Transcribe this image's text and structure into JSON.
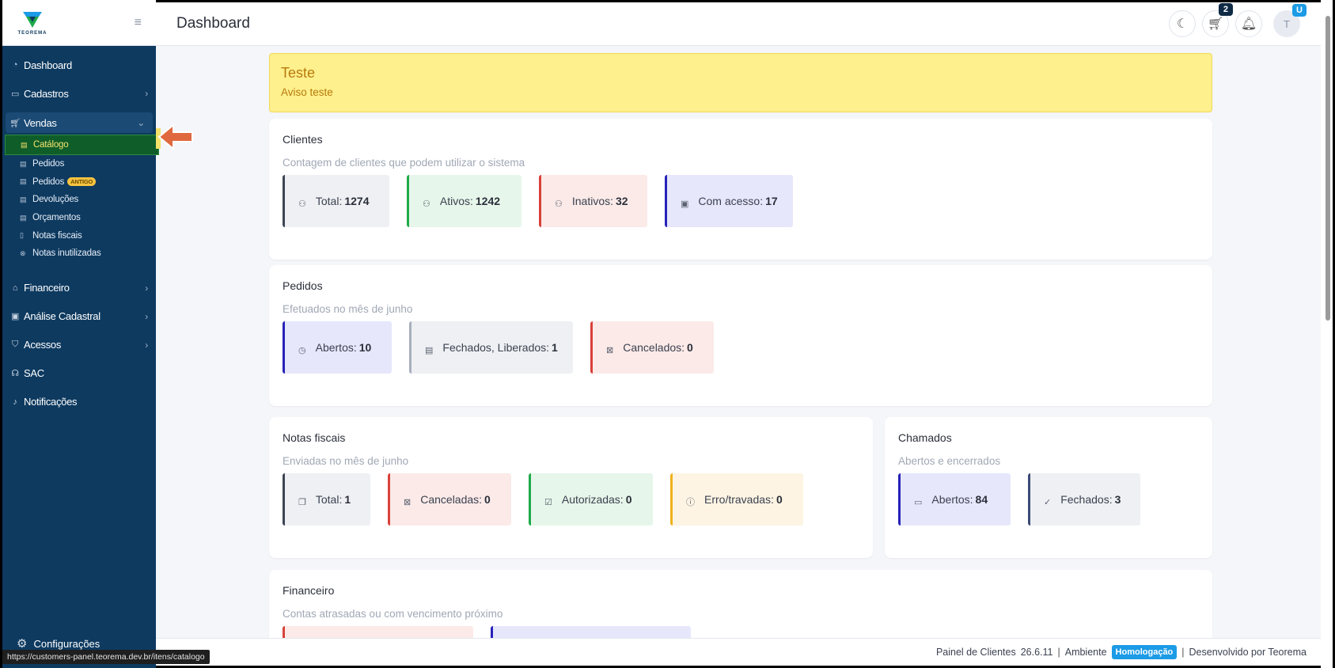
{
  "app": {
    "logo_text": "TEOREMA",
    "page_title": "Dashboard"
  },
  "sidebar": {
    "items": [
      {
        "label": "Dashboard",
        "icon": "gauge-icon"
      },
      {
        "label": "Cadastros",
        "icon": "id-card-icon"
      },
      {
        "label": "Vendas",
        "icon": "cart-icon"
      },
      {
        "label": "Financeiro",
        "icon": "bank-icon"
      },
      {
        "label": "Análise Cadastral",
        "icon": "clipboard-icon"
      },
      {
        "label": "Acessos",
        "icon": "shield-icon"
      },
      {
        "label": "SAC",
        "icon": "headset-icon"
      },
      {
        "label": "Notificações",
        "icon": "bell-icon"
      }
    ],
    "vendas_sub": [
      {
        "label": "Catálogo"
      },
      {
        "label": "Pedidos"
      },
      {
        "label": "Pedidos",
        "badge": "ANTIGO"
      },
      {
        "label": "Devoluções"
      },
      {
        "label": "Orçamentos"
      },
      {
        "label": "Notas fiscais"
      },
      {
        "label": "Notas inutilizadas"
      }
    ],
    "config_label": "Configurações"
  },
  "header": {
    "cart_count": "2",
    "avatar_letter": "T",
    "avatar_badge": "U"
  },
  "alert": {
    "title": "Teste",
    "message": "Aviso teste"
  },
  "clientes": {
    "title": "Clientes",
    "subtitle": "Contagem de clientes que podem utilizar o sistema",
    "stats": [
      {
        "label": "Total:",
        "value": "1274"
      },
      {
        "label": "Ativos:",
        "value": "1242"
      },
      {
        "label": "Inativos:",
        "value": "32"
      },
      {
        "label": "Com acesso:",
        "value": "17"
      }
    ]
  },
  "pedidos": {
    "title": "Pedidos",
    "subtitle": "Efetuados no mês de junho",
    "stats": [
      {
        "label": "Abertos:",
        "value": "10"
      },
      {
        "label": "Fechados, Liberados:",
        "value": "1"
      },
      {
        "label": "Cancelados:",
        "value": "0"
      }
    ]
  },
  "notas": {
    "title": "Notas fiscais",
    "subtitle": "Enviadas no mês de junho",
    "stats": [
      {
        "label": "Total:",
        "value": "1"
      },
      {
        "label": "Canceladas:",
        "value": "0"
      },
      {
        "label": "Autorizadas:",
        "value": "0"
      },
      {
        "label": "Erro/travadas:",
        "value": "0"
      }
    ]
  },
  "chamados": {
    "title": "Chamados",
    "subtitle": "Abertos e encerrados",
    "stats": [
      {
        "label": "Abertos:",
        "value": "84"
      },
      {
        "label": "Fechados:",
        "value": "3"
      }
    ]
  },
  "financeiro": {
    "title": "Financeiro",
    "subtitle": "Contas atrasadas ou com vencimento próximo"
  },
  "footer": {
    "panel_label": "Painel de Clientes",
    "version": "26.6.11",
    "env_label": "Ambiente",
    "env_badge": "Homologação",
    "dev_label": "Desenvolvido por Teorema"
  },
  "status_url": "https://customers-panel.teorema.dev.br/itens/catalogo"
}
